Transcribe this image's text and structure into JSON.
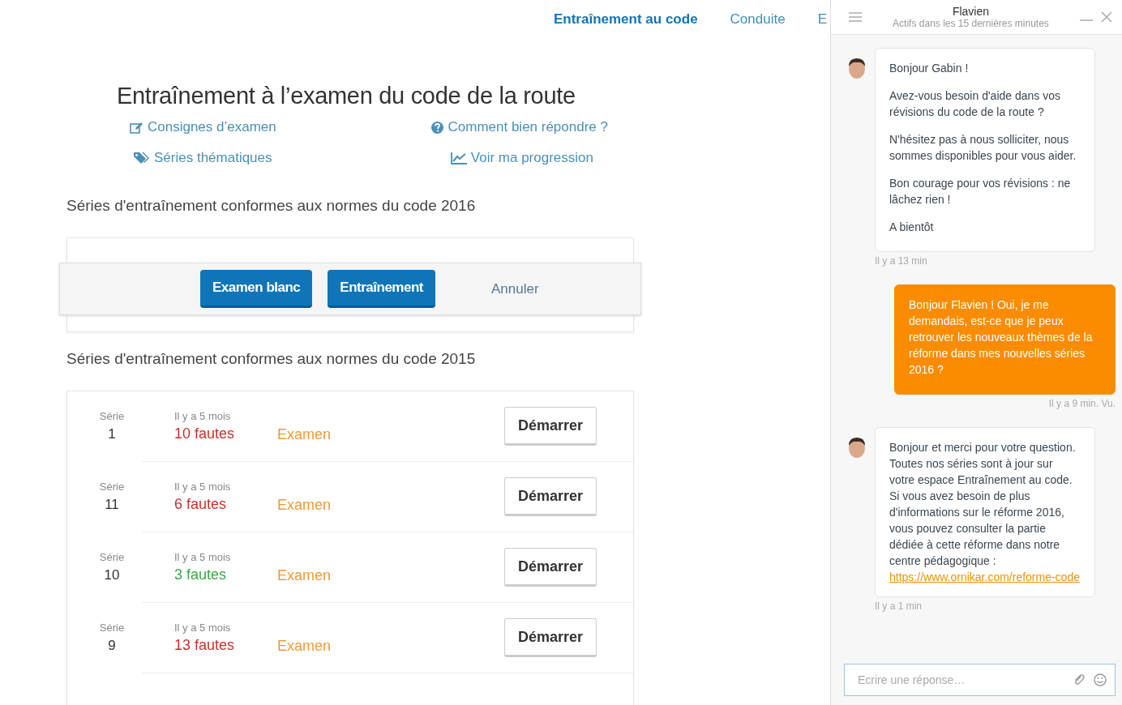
{
  "nav": [
    {
      "label": "Entraînement au code",
      "selected": true
    },
    {
      "label": "Conduite",
      "selected": false
    },
    {
      "label": "E",
      "selected": false
    }
  ],
  "title": "Entraînement à l’examen du code de la route",
  "links": [
    {
      "kind": "edit",
      "label": "Consignes d’examen"
    },
    {
      "kind": "help",
      "label": "Comment bien répondre ?"
    },
    {
      "kind": "tags",
      "label": "Séries thématiques"
    },
    {
      "kind": "chart",
      "label": "Voir ma progression"
    }
  ],
  "section_2016": {
    "heading": "Séries d'entraînement conformes aux normes du code 2016",
    "buttons": [
      "Examen blanc",
      "Entraînement"
    ],
    "cancel": "Annuler"
  },
  "section_2015": {
    "heading": "Séries d'entraînement conformes aux normes du code 2015",
    "rows": [
      {
        "serie_label": "Série",
        "number": "1",
        "date": "Il y a 5 mois",
        "faults": "10 fautes",
        "color": "#c9302c",
        "type": "Examen",
        "action": "Démarrer"
      },
      {
        "serie_label": "Série",
        "number": "11",
        "date": "Il y a 5 mois",
        "faults": "6 fautes",
        "color": "#c9302c",
        "type": "Examen",
        "action": "Démarrer"
      },
      {
        "serie_label": "Série",
        "number": "10",
        "date": "Il y a 5 mois",
        "faults": "3 fautes",
        "color": "#3aa84a",
        "type": "Examen",
        "action": "Démarrer"
      },
      {
        "serie_label": "Série",
        "number": "9",
        "date": "Il y a 5 mois",
        "faults": "13 fautes",
        "color": "#c9302c",
        "type": "Examen",
        "action": "Démarrer"
      }
    ]
  },
  "chat": {
    "name": "Flavien",
    "status": "Actifs dans les 15 dernières minutes",
    "messages": [
      {
        "kind": "received",
        "paragraphs": [
          "Bonjour Gabin !",
          "Avez-vous besoin d'aide dans vos révisions du code de la route ?",
          "N'hésitez pas à nous solliciter, nous sommes disponibles pour vous aider.",
          "Bon courage pour vos révisions : ne lâchez rien !",
          "A bientôt"
        ],
        "time": "Il y a 13 min"
      },
      {
        "kind": "sent",
        "paragraphs": [
          "Bonjour Flavien ! Oui, je me demandais, est-ce que je peux retrouver les nouveaux thèmes de la réforme dans mes nouvelles séries 2016 ?"
        ],
        "time": "Il y a 9 min. Vu."
      },
      {
        "kind": "received",
        "paragraphs": [
          "Bonjour et merci pour votre question. Toutes nos séries sont à jour sur votre espace Entraînement au code. Si vous avez besoin de plus d'informations sur le réforme 2016, vous pouvez consulter la partie dédiée à cette réforme dans notre centre pédagogique :"
        ],
        "link": "https://www.ornikar.com/reforme-code",
        "time": "Il y a 1 min"
      }
    ],
    "input": {
      "placeholder": "Ecrire une réponse…"
    }
  }
}
